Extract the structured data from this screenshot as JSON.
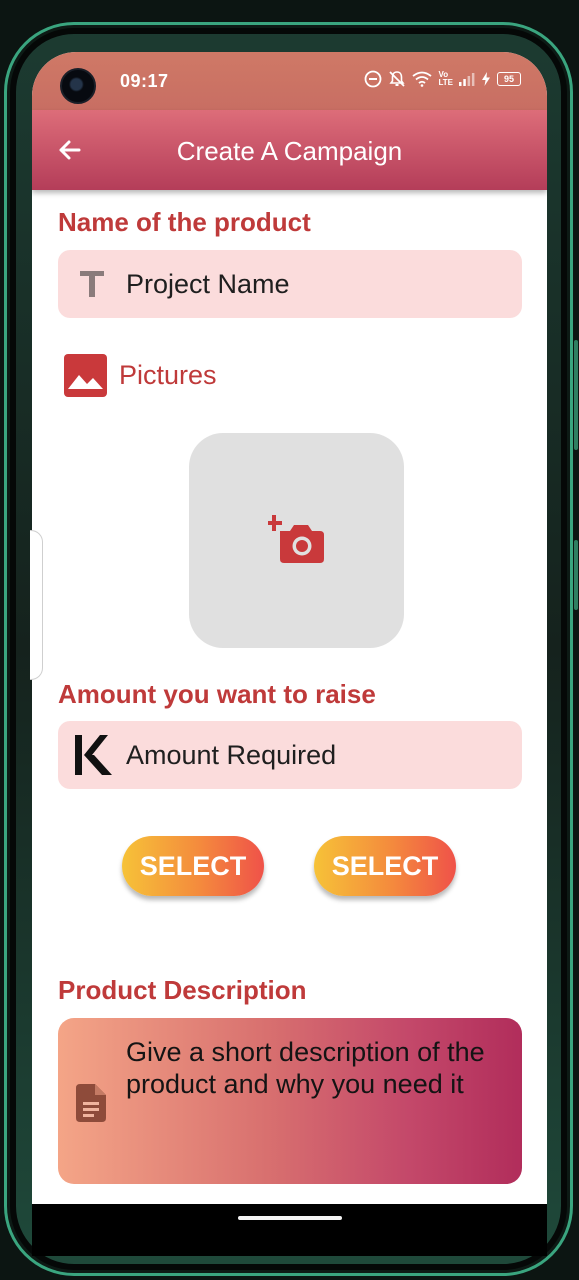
{
  "status_bar": {
    "time": "09:17",
    "volte_top": "Vo",
    "volte_bottom": "LTE",
    "battery": "95"
  },
  "app_bar": {
    "title": "Create A Campaign"
  },
  "product_name": {
    "label": "Name of the product",
    "placeholder": "Project Name",
    "icon": "text-fields-icon"
  },
  "pictures": {
    "label": "Pictures",
    "icon": "image-icon",
    "add_photo_icon": "add-a-photo-icon"
  },
  "amount": {
    "label": "Amount you want to raise",
    "placeholder": "Amount Required",
    "icon": "kwacha-currency-icon"
  },
  "select_buttons": [
    {
      "label": "SELECT"
    },
    {
      "label": "SELECT"
    }
  ],
  "description": {
    "label": "Product Description",
    "placeholder": "Give a short description of the product and why you need it",
    "icon": "document-icon"
  },
  "colors": {
    "accent_red": "#bf3a3a",
    "field_background": "#fbdcdc",
    "app_bar_top": "#dd6d79",
    "app_bar_bottom": "#b43d59",
    "button_gradient_start": "#f6c238",
    "button_gradient_end": "#ef5249"
  }
}
